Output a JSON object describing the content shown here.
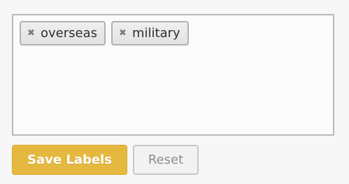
{
  "labels": [
    {
      "text": "overseas",
      "remove_icon": "close-icon"
    },
    {
      "text": "military",
      "remove_icon": "close-icon"
    }
  ],
  "buttons": {
    "save_label": "Save Labels",
    "reset_label": "Reset"
  },
  "colors": {
    "save_button": "#e5b840",
    "chip_border": "#b1b1b1",
    "box_border": "#b9b9b9"
  }
}
